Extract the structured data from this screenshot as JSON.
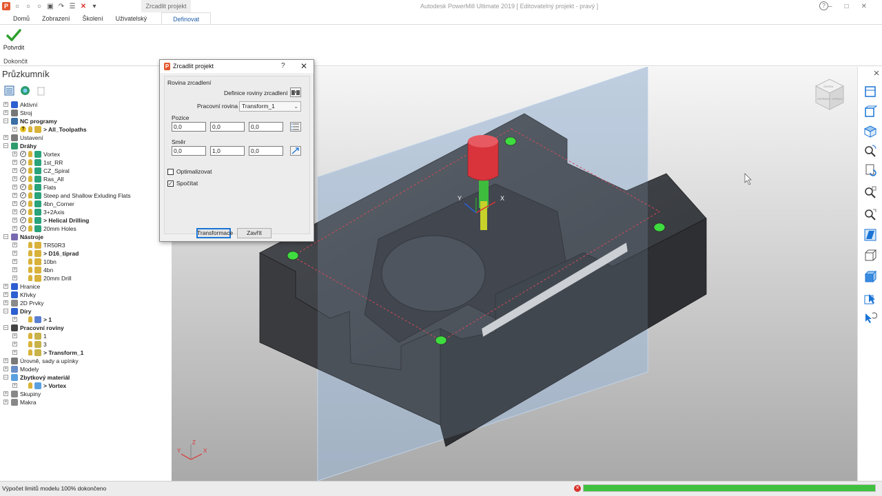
{
  "title_bar": {
    "contextual_tab": "Zrcadlit projekt",
    "app_title": "Autodesk PowerMill Ultimate 2019   [ Editovatelný projekt - pravý ]"
  },
  "ribbon": {
    "tabs": [
      "Domů",
      "Zobrazení",
      "Školení",
      "Uživatelský",
      "Definovat"
    ],
    "confirm_label": "Potvrdit",
    "group_label": "Dokončit"
  },
  "explorer": {
    "title": "Průzkumník",
    "tree": [
      {
        "label": "Aktivní",
        "level": 0,
        "icon": "active-folder-icon"
      },
      {
        "label": "Stroj",
        "level": 0,
        "icon": "machine-icon"
      },
      {
        "label": "NC programy",
        "level": 0,
        "icon": "nc-programs-icon",
        "bold": true
      },
      {
        "label": "> All_Toolpaths",
        "level": 1,
        "icon": "nc-program-icon",
        "bold": true,
        "q": true
      },
      {
        "label": "Ustavení",
        "level": 0,
        "icon": "setup-icon"
      },
      {
        "label": "Dráhy",
        "level": 0,
        "icon": "toolpaths-icon",
        "bold": true
      },
      {
        "label": "Vortex",
        "level": 1,
        "icon": "toolpath-icon"
      },
      {
        "label": "1st_RR",
        "level": 1,
        "icon": "toolpath-icon"
      },
      {
        "label": "CZ_Spiral",
        "level": 1,
        "icon": "toolpath-icon"
      },
      {
        "label": "Ras_All",
        "level": 1,
        "icon": "toolpath-icon"
      },
      {
        "label": "Flats",
        "level": 1,
        "icon": "toolpath-icon"
      },
      {
        "label": "Steep and Shallow Exluding Flats",
        "level": 1,
        "icon": "toolpath-icon"
      },
      {
        "label": "4bn_Corner",
        "level": 1,
        "icon": "toolpath-icon"
      },
      {
        "label": "3+2Axis",
        "level": 1,
        "icon": "toolpath-icon"
      },
      {
        "label": "> Helical Drilling",
        "level": 1,
        "icon": "toolpath-icon",
        "bold": true
      },
      {
        "label": "20mm Holes",
        "level": 1,
        "icon": "toolpath-icon"
      },
      {
        "label": "Nástroje",
        "level": 0,
        "icon": "tools-icon",
        "bold": true
      },
      {
        "label": "TR50R3",
        "level": 1,
        "icon": "tool-icon"
      },
      {
        "label": "> D16_tiprad",
        "level": 1,
        "icon": "tool-icon",
        "bold": true
      },
      {
        "label": "10bn",
        "level": 1,
        "icon": "tool-icon"
      },
      {
        "label": "4bn",
        "level": 1,
        "icon": "tool-icon"
      },
      {
        "label": "20mm Drill",
        "level": 1,
        "icon": "tool-icon"
      },
      {
        "label": "Hranice",
        "level": 0,
        "icon": "boundary-icon"
      },
      {
        "label": "Křivky",
        "level": 0,
        "icon": "curves-icon"
      },
      {
        "label": "2D Prvky",
        "level": 0,
        "icon": "2d-features-icon"
      },
      {
        "label": "Díry",
        "level": 0,
        "icon": "holes-icon",
        "bold": true
      },
      {
        "label": "> 1",
        "level": 1,
        "icon": "hole-set-icon",
        "bold": true
      },
      {
        "label": "Pracovní roviny",
        "level": 0,
        "icon": "workplanes-icon",
        "bold": true
      },
      {
        "label": "1",
        "level": 1,
        "icon": "workplane-icon"
      },
      {
        "label": "3",
        "level": 1,
        "icon": "workplane-icon"
      },
      {
        "label": "> Transform_1",
        "level": 1,
        "icon": "workplane-icon",
        "bold": true
      },
      {
        "label": "Úrovně, sady a upínky",
        "level": 0,
        "icon": "levels-icon"
      },
      {
        "label": "Modely",
        "level": 0,
        "icon": "models-icon"
      },
      {
        "label": "Zbytkový materiál",
        "level": 0,
        "icon": "stock-model-icon",
        "bold": true
      },
      {
        "label": "> Vortex",
        "level": 1,
        "icon": "stock-icon",
        "bold": true
      },
      {
        "label": "Skupiny",
        "level": 0,
        "icon": "groups-icon"
      },
      {
        "label": "Makra",
        "level": 0,
        "icon": "macros-icon"
      }
    ]
  },
  "dialog": {
    "title": "Zrcadlit projekt",
    "help": "?",
    "section_label": "Rovina zrcadlení",
    "definition_label": "Definice roviny zrcadlení",
    "workplane_label": "Pracovní rovina",
    "workplane_value": "Transform_1",
    "position_label": "Pozice",
    "position": [
      "0,0",
      "0,0",
      "0,0"
    ],
    "direction_label": "Směr",
    "direction": [
      "0,0",
      "1,0",
      "0,0"
    ],
    "optimize_label": "Optimalizovat",
    "optimize_checked": false,
    "calculate_label": "Spočítat",
    "calculate_checked": true,
    "transform_button": "Transformace",
    "close_button": "Zavřít"
  },
  "viewport": {
    "axis_labels": {
      "x": "X",
      "y": "Y",
      "z": "Z"
    },
    "viewcube_labels": {
      "top": "SHORA",
      "front": "ZEPŘEDU",
      "right": "VPRAVO"
    }
  },
  "status": {
    "text": "Výpočet limitů modelu 100% dokončeno",
    "progress_percent": 100,
    "progress_color": "#3fc13f"
  },
  "colors": {
    "accent": "#1f5fa8",
    "part": "#3a3c40",
    "mirror_plane": "#9fb8d4",
    "tool_holder": "#d9343c",
    "tool_tip": "#c8d12a"
  }
}
